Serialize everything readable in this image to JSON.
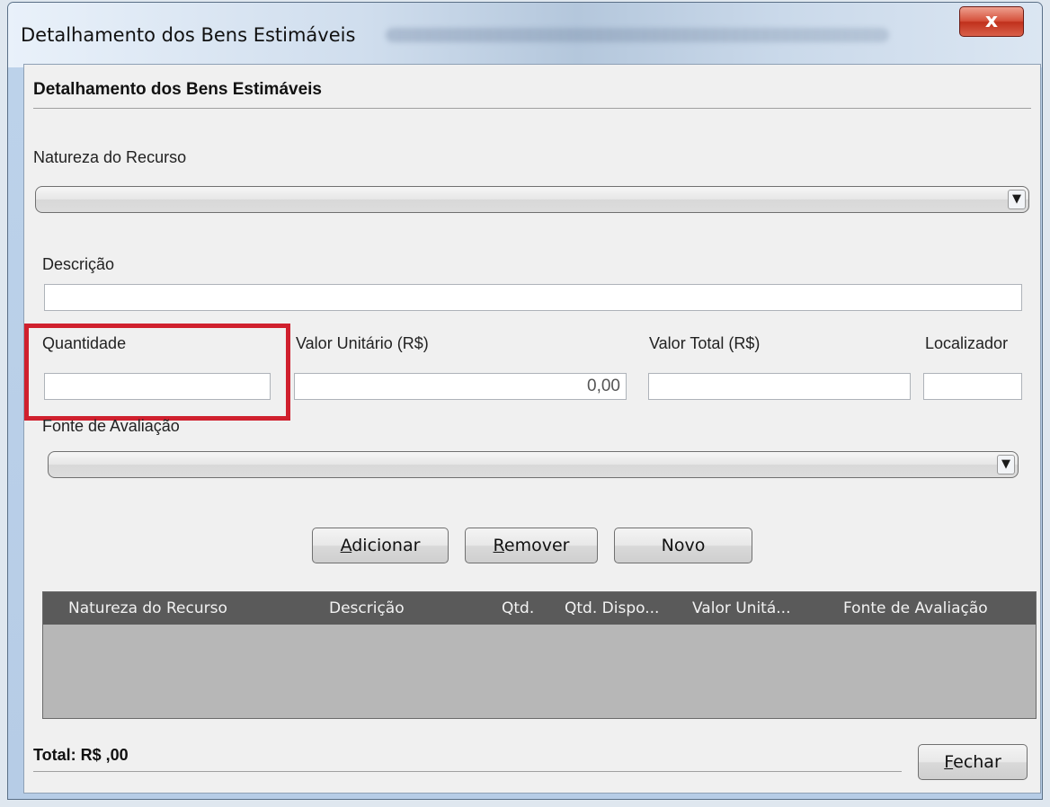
{
  "window": {
    "title": "Detalhamento dos Bens Estimáveis",
    "close_label": "x"
  },
  "panel": {
    "heading": "Detalhamento dos Bens Estimáveis"
  },
  "form": {
    "natureza_label": "Natureza do Recurso",
    "natureza_value": "",
    "descricao_label": "Descrição",
    "descricao_value": "",
    "quantidade_label": "Quantidade",
    "quantidade_value": "",
    "valor_unitario_label": "Valor Unitário (R$)",
    "valor_unitario_value": "0,00",
    "valor_total_label": "Valor Total (R$)",
    "valor_total_value": "",
    "localizador_label": "Localizador",
    "localizador_value": "",
    "fonte_label": "Fonte de Avaliação",
    "fonte_value": ""
  },
  "buttons": {
    "adicionar": {
      "mnemonic": "A",
      "rest": "dicionar"
    },
    "remover": {
      "mnemonic": "R",
      "rest": "emover"
    },
    "novo": "Novo",
    "fechar": {
      "mnemonic": "F",
      "rest": "echar"
    }
  },
  "table": {
    "columns": [
      "Natureza do Recurso",
      "Descrição",
      "Qtd.",
      "Qtd. Dispo...",
      "Valor Unitá...",
      "Fonte de Avaliação"
    ],
    "rows": []
  },
  "footer": {
    "total": "Total: R$  ,00"
  },
  "colors": {
    "highlight": "#d0202e",
    "table_header": "#5a5a5a",
    "table_body": "#b7b7b7"
  }
}
